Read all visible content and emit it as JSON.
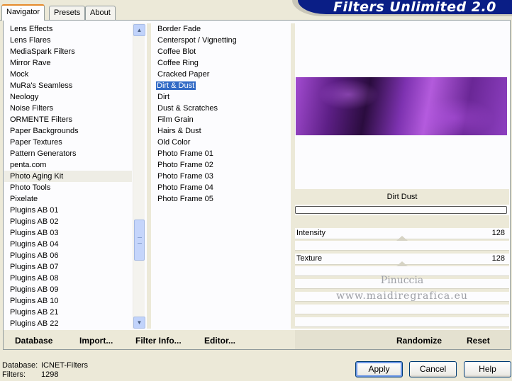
{
  "header": {
    "title": "Filters Unlimited 2.0"
  },
  "tabs": [
    {
      "label": "Navigator",
      "active": true
    },
    {
      "label": "Presets",
      "active": false
    },
    {
      "label": "About",
      "active": false
    }
  ],
  "categories": {
    "items": [
      "Lens Effects",
      "Lens Flares",
      "MediaSpark Filters",
      "Mirror Rave",
      "Mock",
      "MuRa's Seamless",
      "Neology",
      "Noise Filters",
      "ORMENTE Filters",
      "Paper Backgrounds",
      "Paper Textures",
      "Pattern Generators",
      "penta.com",
      "Photo Aging Kit",
      "Photo Tools",
      "Pixelate",
      "Plugins AB 01",
      "Plugins AB 02",
      "Plugins AB 03",
      "Plugins AB 04",
      "Plugins AB 06",
      "Plugins AB 07",
      "Plugins AB 08",
      "Plugins AB 09",
      "Plugins AB 10",
      "Plugins AB 21",
      "Plugins AB 22"
    ],
    "selected": "Photo Aging Kit"
  },
  "filters": {
    "items": [
      "Border Fade",
      "Centerspot / Vignetting",
      "Coffee Blot",
      "Coffee Ring",
      "Cracked Paper",
      "Dirt & Dust",
      "Dirt",
      "Dust & Scratches",
      "Film Grain",
      "Hairs & Dust",
      "Old Color",
      "Photo Frame 01",
      "Photo Frame 02",
      "Photo Frame 03",
      "Photo Frame 04",
      "Photo Frame 05"
    ],
    "selected": "Dirt & Dust"
  },
  "preview": {
    "filter_name": "Dirt  Dust",
    "progress": 0
  },
  "sliders": [
    {
      "label": "Intensity",
      "value": "128",
      "fraction": 0.5
    },
    {
      "label": "Texture",
      "value": "128",
      "fraction": 0.5
    }
  ],
  "watermark": {
    "line1": "Pinuccia",
    "line2": "www.maidiregrafica.eu"
  },
  "links": {
    "database": "Database",
    "import": "Import...",
    "filter_info": "Filter Info...",
    "editor": "Editor...",
    "randomize": "Randomize",
    "reset": "Reset"
  },
  "status": {
    "database_label": "Database:",
    "database_value": "ICNET-Filters",
    "filters_label": "Filters:",
    "filters_value": "1298"
  },
  "buttons": {
    "apply": "Apply",
    "cancel": "Cancel",
    "help": "Help"
  },
  "colors": {
    "window_bg": "#ece9d8",
    "banner": "#0a1e86",
    "selection": "#316ac5"
  },
  "icons": {
    "scroll_up": "chevron-up-icon",
    "scroll_down": "chevron-down-icon"
  }
}
